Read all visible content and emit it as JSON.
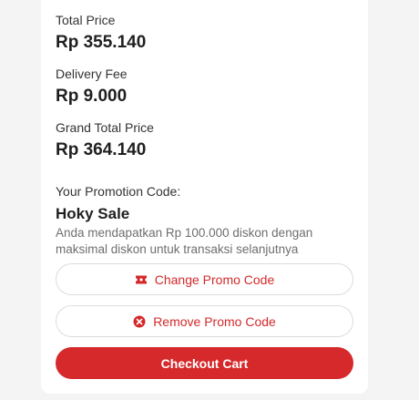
{
  "summary": {
    "total_price_label": "Total Price",
    "total_price_value": "Rp 355.140",
    "delivery_fee_label": "Delivery Fee",
    "delivery_fee_value": "Rp 9.000",
    "grand_total_label": "Grand Total Price",
    "grand_total_value": "Rp 364.140"
  },
  "promo": {
    "section_label": "Your Promotion Code:",
    "name": "Hoky Sale",
    "description": "Anda mendapatkan Rp 100.000 diskon dengan maksimal diskon untuk transaksi selanjutnya"
  },
  "actions": {
    "change_promo_label": "Change Promo Code",
    "change_promo_icon": "ticket-icon",
    "remove_promo_label": "Remove Promo Code",
    "remove_promo_icon": "remove-circle-icon",
    "checkout_label": "Checkout Cart"
  },
  "colors": {
    "accent": "#d6292b",
    "background": "#f4f4f4",
    "card": "#ffffff"
  }
}
